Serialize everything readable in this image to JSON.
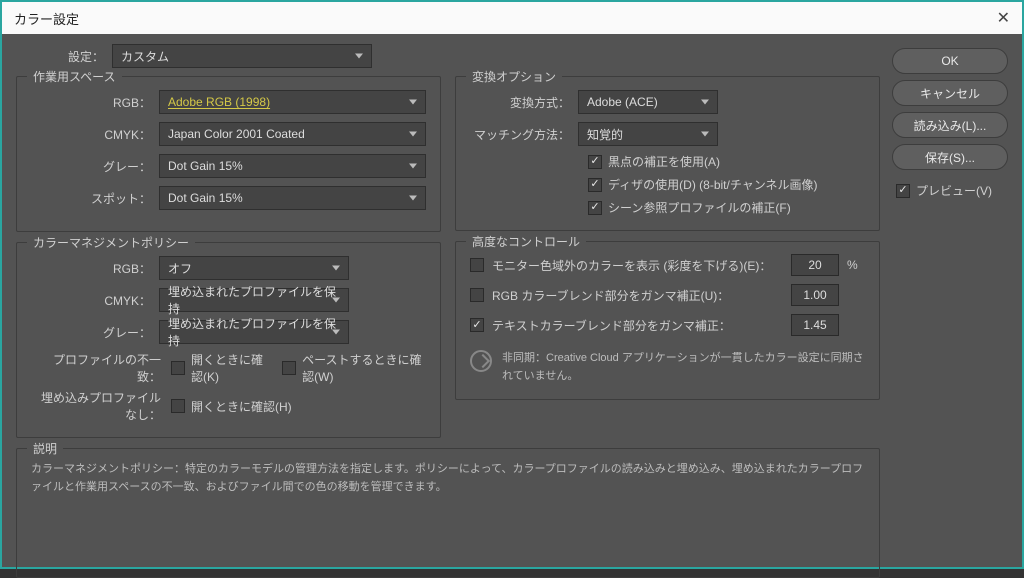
{
  "title": "カラー設定",
  "buttons": {
    "ok": "OK",
    "cancel": "キャンセル",
    "load": "読み込み(L)...",
    "save": "保存(S)..."
  },
  "preview": {
    "label": "プレビュー(V)"
  },
  "settings": {
    "label": "設定：",
    "value": "カスタム"
  },
  "workspace": {
    "title": "作業用スペース",
    "rgb_label": "RGB：",
    "rgb": "Adobe RGB (1998)",
    "cmyk_label": "CMYK：",
    "cmyk": "Japan Color 2001 Coated",
    "gray_label": "グレー：",
    "gray": "Dot Gain 15%",
    "spot_label": "スポット：",
    "spot": "Dot Gain 15%"
  },
  "policy": {
    "title": "カラーマネジメントポリシー",
    "rgb_label": "RGB：",
    "rgb": "オフ",
    "cmyk_label": "CMYK：",
    "cmyk": "埋め込まれたプロファイルを保持",
    "gray_label": "グレー：",
    "gray": "埋め込まれたプロファイルを保持",
    "mismatch_label": "プロファイルの不一致：",
    "ask_open": "開くときに確認(K)",
    "ask_paste": "ペーストするときに確認(W)",
    "missing_label": "埋め込みプロファイルなし：",
    "ask_open2": "開くときに確認(H)"
  },
  "convert": {
    "title": "変換オプション",
    "engine_label": "変換方式：",
    "engine": "Adobe (ACE)",
    "intent_label": "マッチング方法：",
    "intent": "知覚的",
    "bpc": "黒点の補正を使用(A)",
    "dither": "ディザの使用(D) (8-bit/チャンネル画像)",
    "scene": "シーン参照プロファイルの補正(F)"
  },
  "advanced": {
    "title": "高度なコントロール",
    "desat_label": "モニター色域外のカラーを表示 (彩度を下げる)(E)：",
    "desat_val": "20",
    "desat_unit": "%",
    "rgb_gamma_label": "RGB カラーブレンド部分をガンマ補正(U)：",
    "rgb_gamma_val": "1.00",
    "text_gamma_label": "テキストカラーブレンド部分をガンマ補正：",
    "text_gamma_val": "1.45"
  },
  "sync": {
    "text": "非同期：Creative Cloud アプリケーションが一貫したカラー設定に同期されていません。"
  },
  "description": {
    "title": "説明",
    "text": "カラーマネジメントポリシー：特定のカラーモデルの管理方法を指定します。ポリシーによって、カラープロファイルの読み込みと埋め込み、埋め込まれたカラープロファイルと作業用スペースの不一致、およびファイル間での色の移動を管理できます。"
  }
}
